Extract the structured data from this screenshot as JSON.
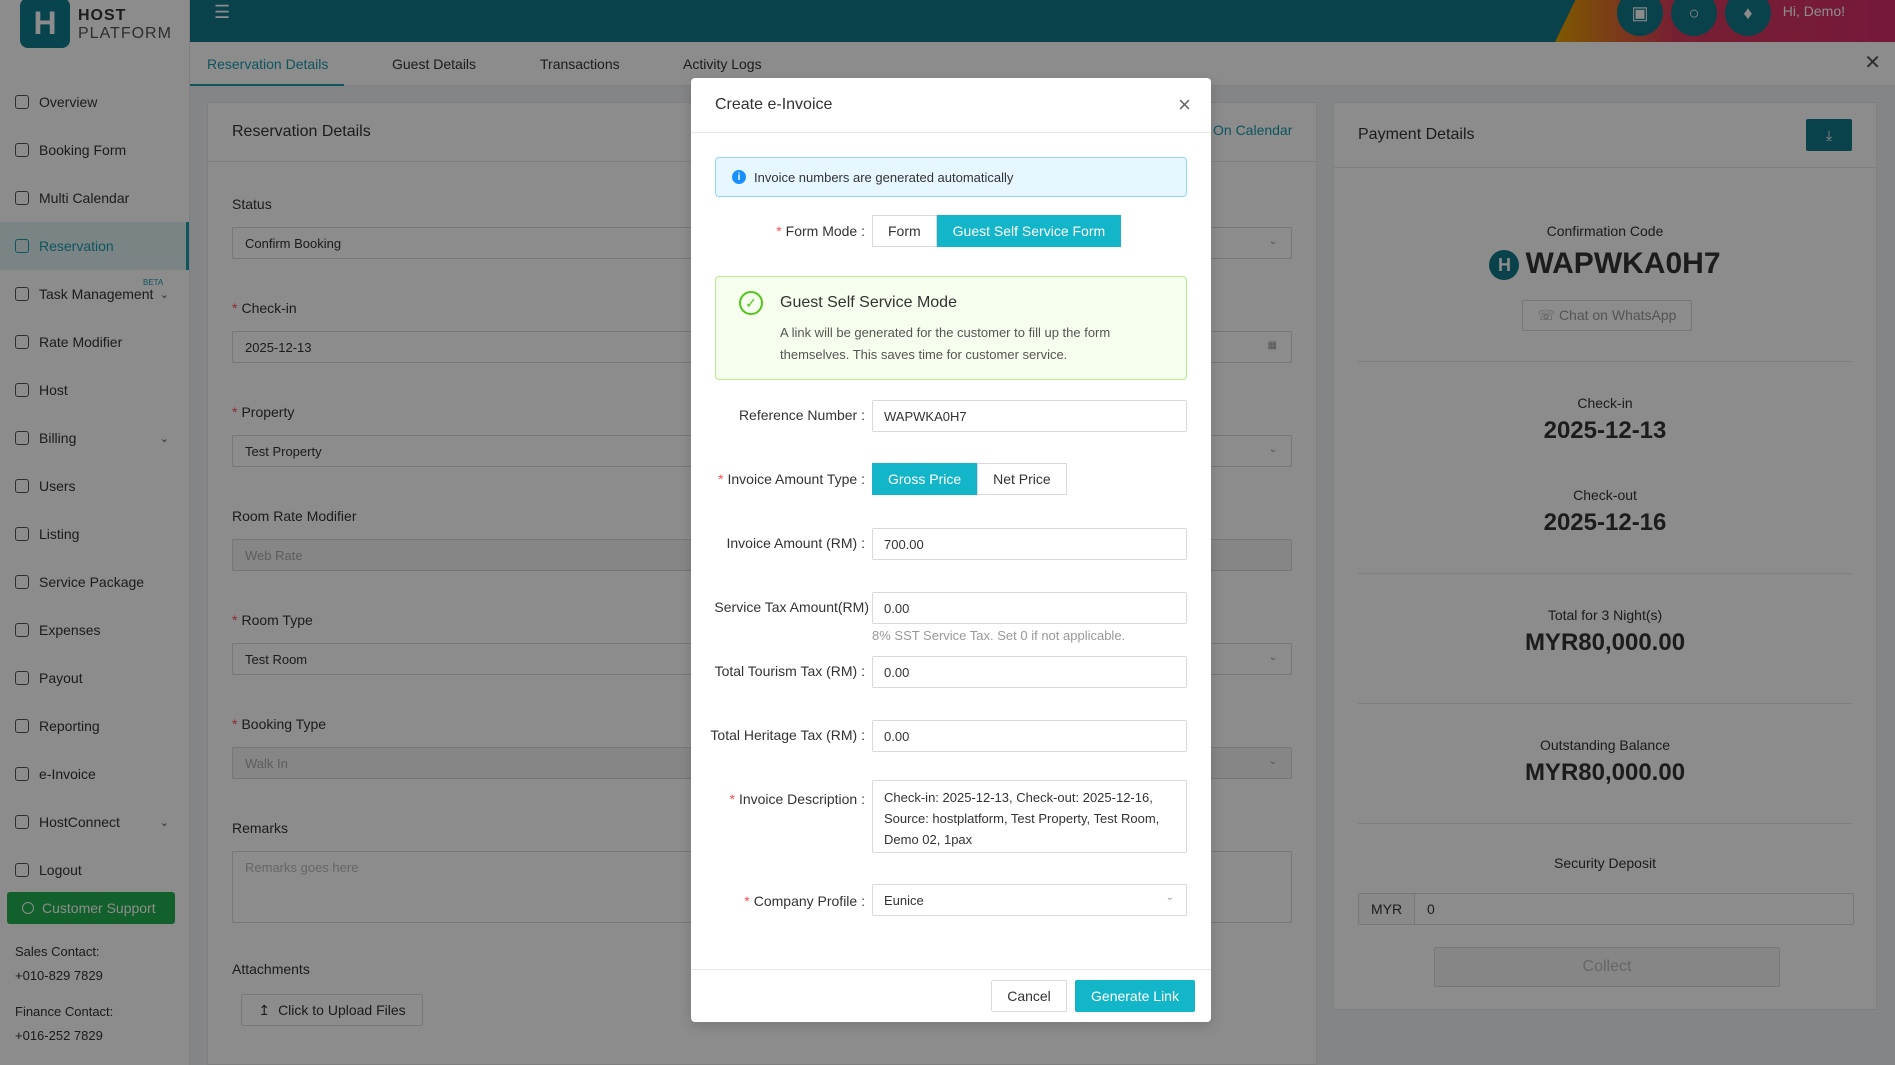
{
  "brand": {
    "logo_letter": "H",
    "name_top": "HOST",
    "name_bottom": "PLATFORM"
  },
  "sidebar": {
    "items": [
      {
        "label": "Overview",
        "icon": "home-icon"
      },
      {
        "label": "Booking Form",
        "icon": "form-icon"
      },
      {
        "label": "Multi Calendar",
        "icon": "calendar-icon"
      },
      {
        "label": "Reservation",
        "icon": "list-icon",
        "active": true
      },
      {
        "label": "Task Management",
        "icon": "task-icon",
        "badge": "BETA",
        "expandable": true
      },
      {
        "label": "Rate Modifier",
        "icon": "rate-icon"
      },
      {
        "label": "Host",
        "icon": "host-icon"
      },
      {
        "label": "Billing",
        "icon": "billing-icon",
        "expandable": true
      },
      {
        "label": "Users",
        "icon": "user-icon"
      },
      {
        "label": "Listing",
        "icon": "listing-icon"
      },
      {
        "label": "Service Package",
        "icon": "share-icon"
      },
      {
        "label": "Expenses",
        "icon": "cart-icon"
      },
      {
        "label": "Payout",
        "icon": "payout-icon"
      },
      {
        "label": "Reporting",
        "icon": "chart-icon"
      },
      {
        "label": "e-Invoice",
        "icon": "invoice-icon"
      },
      {
        "label": "HostConnect",
        "icon": "link-icon",
        "expandable": true
      },
      {
        "label": "Logout",
        "icon": "logout-icon"
      }
    ],
    "support_label": "Customer Support",
    "sales_label": "Sales Contact:",
    "sales_phone": "+010-829 7829",
    "finance_label": "Finance Contact:",
    "finance_phone": "+016-252 7829"
  },
  "topbar": {
    "greeting": "Hi, Demo!"
  },
  "tabs": [
    "Reservation Details",
    "Guest Details",
    "Transactions",
    "Activity Logs"
  ],
  "reservation": {
    "title": "Reservation Details",
    "on_calendar": "On Calendar",
    "status_label": "Status",
    "status_value": "Confirm Booking",
    "checkin_label": "Check-in",
    "checkin_value": "2025-12-13",
    "property_label": "Property",
    "property_value": "Test Property",
    "rate_modifier_label": "Room Rate Modifier",
    "rate_modifier_value": "Web Rate",
    "room_type_label": "Room Type",
    "room_type_value": "Test Room",
    "booking_type_label": "Booking Type",
    "booking_type_value": "Walk In",
    "remarks_label": "Remarks",
    "remarks_placeholder": "Remarks goes here",
    "attachments_label": "Attachments",
    "upload_label": "Click to Upload Files"
  },
  "payment": {
    "title": "Payment Details",
    "confirmation_label": "Confirmation Code",
    "confirmation_code": "WAPWKA0H7",
    "whatsapp_label": "Chat on WhatsApp",
    "checkin_label": "Check-in",
    "checkin_value": "2025-12-13",
    "checkout_label": "Check-out",
    "checkout_value": "2025-12-16",
    "total_label": "Total for 3 Night(s)",
    "total_value": "MYR80,000.00",
    "outstanding_label": "Outstanding Balance",
    "outstanding_value": "MYR80,000.00",
    "deposit_label": "Security Deposit",
    "deposit_currency": "MYR",
    "deposit_value": "0",
    "collect_label": "Collect"
  },
  "modal": {
    "title": "Create e-Invoice",
    "info": "Invoice numbers are generated automatically",
    "form_mode_label": "Form Mode",
    "form_mode_options": [
      "Form",
      "Guest Self Service Form"
    ],
    "form_mode_selected": "Guest Self Service Form",
    "success_title": "Guest Self Service Mode",
    "success_desc": "A link will be generated for the customer to fill up the form themselves. This saves time for customer service.",
    "reference_label": "Reference Number",
    "reference_value": "WAPWKA0H7",
    "amount_type_label": "Invoice Amount Type",
    "amount_type_options": [
      "Gross Price",
      "Net Price"
    ],
    "amount_type_selected": "Gross Price",
    "amount_label": "Invoice Amount (RM)",
    "amount_value": "700.00",
    "service_tax_label": "Service Tax Amount(RM)",
    "service_tax_value": "0.00",
    "service_tax_hint": "8% SST Service Tax. Set 0 if not applicable.",
    "tourism_label": "Total Tourism Tax (RM)",
    "tourism_value": "0.00",
    "heritage_label": "Total Heritage Tax (RM)",
    "heritage_value": "0.00",
    "description_label": "Invoice Description",
    "description_value": "Check-in: 2025-12-13, Check-out: 2025-12-16, Source: hostplatform, Test Property, Test Room, Demo 02, 1pax",
    "company_label": "Company Profile",
    "company_value": "Eunice",
    "cancel_label": "Cancel",
    "generate_label": "Generate Link"
  },
  "colors": {
    "primary": "#13b5c9",
    "topbar": "#13798a",
    "success": "#52c41a",
    "info": "#1890ff"
  }
}
